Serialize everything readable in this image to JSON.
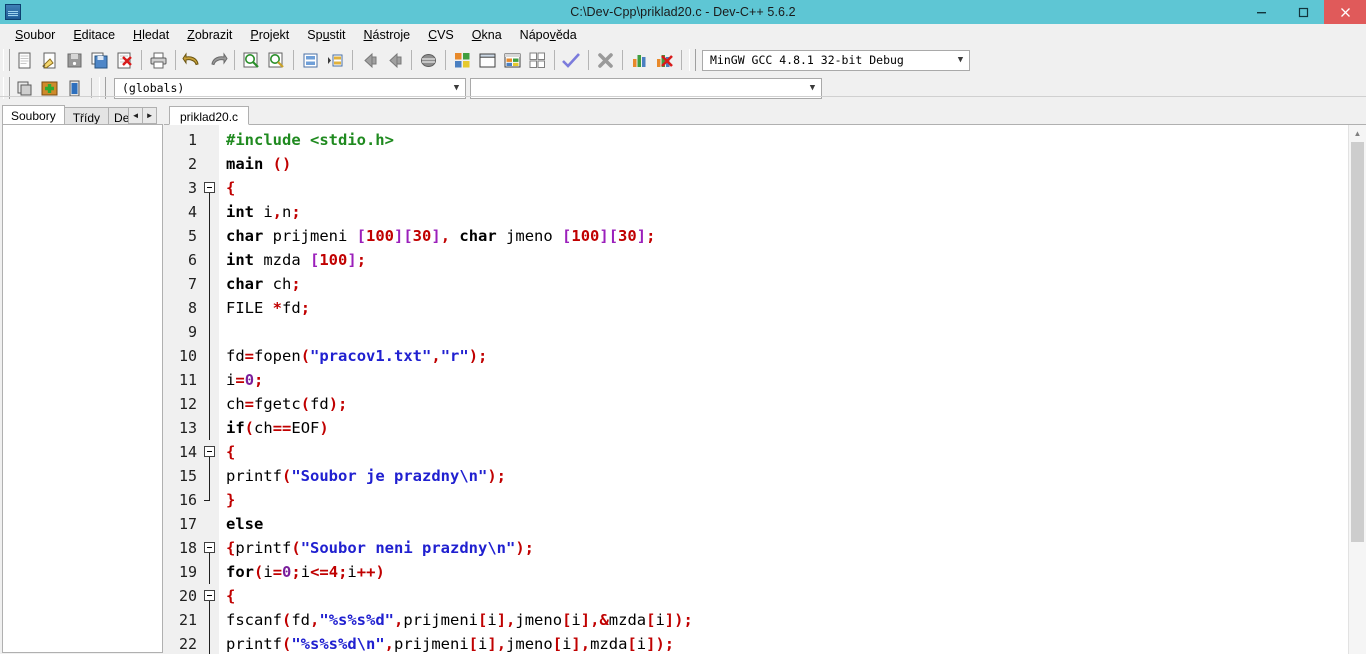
{
  "window": {
    "title": "C:\\Dev-Cpp\\priklad20.c - Dev-C++ 5.6.2",
    "app_icon": "devcpp-icon",
    "titlebar_color": "#5ec6d4",
    "close_color": "#e05a5a",
    "minimize_label": "–",
    "maximize_label": "❐",
    "close_label": "✕"
  },
  "menubar": {
    "items": [
      {
        "label": "Soubor",
        "accel": "S"
      },
      {
        "label": "Editace",
        "accel": "E"
      },
      {
        "label": "Hledat",
        "accel": "H"
      },
      {
        "label": "Zobrazit",
        "accel": "Z"
      },
      {
        "label": "Projekt",
        "accel": "P"
      },
      {
        "label": "Spustit",
        "accel": "u"
      },
      {
        "label": "Nástroje",
        "accel": "N"
      },
      {
        "label": "CVS",
        "accel": "C"
      },
      {
        "label": "Okna",
        "accel": "O"
      },
      {
        "label": "Nápověda",
        "accel": "v"
      }
    ]
  },
  "toolbar1": {
    "buttons": [
      {
        "name": "new-file-icon",
        "tooltip": "Nový zdrojový soubor"
      },
      {
        "name": "open-file-icon",
        "tooltip": "Otevřít"
      },
      {
        "name": "save-file-icon",
        "tooltip": "Uložit"
      },
      {
        "name": "save-all-icon",
        "tooltip": "Uložit vše"
      },
      {
        "name": "close-file-icon",
        "tooltip": "Zavřít"
      },
      {
        "name": "print-icon",
        "tooltip": "Tisk"
      },
      {
        "name": "undo-icon",
        "tooltip": "Zpět"
      },
      {
        "name": "redo-icon",
        "tooltip": "Znovu"
      },
      {
        "name": "find-icon",
        "tooltip": "Hledat"
      },
      {
        "name": "replace-icon",
        "tooltip": "Nahradit"
      },
      {
        "name": "goto-line-icon",
        "tooltip": "Jít na řádek"
      },
      {
        "name": "indent-icon",
        "tooltip": "Odsadit"
      },
      {
        "name": "back-icon",
        "tooltip": "Zpět"
      },
      {
        "name": "forward-icon",
        "tooltip": "Vpřed"
      },
      {
        "name": "toggle-bookmark-icon",
        "tooltip": "Záložka"
      },
      {
        "name": "compile-icon",
        "tooltip": "Přeložit"
      },
      {
        "name": "run-icon",
        "tooltip": "Spustit"
      },
      {
        "name": "compile-run-icon",
        "tooltip": "Přeložit a spustit"
      },
      {
        "name": "rebuild-all-icon",
        "tooltip": "Přeložit vše"
      },
      {
        "name": "syntax-check-icon",
        "tooltip": "Kontrola syntaxe"
      },
      {
        "name": "stop-execution-icon",
        "tooltip": "Zastavit"
      },
      {
        "name": "profile-icon",
        "tooltip": "Profilování"
      },
      {
        "name": "delete-profile-icon",
        "tooltip": "Smazat profil"
      }
    ],
    "compiler_combo": {
      "value": "MinGW GCC 4.8.1 32-bit Debug",
      "arrow": "▼"
    }
  },
  "toolbar2": {
    "buttons": [
      {
        "name": "new-project-icon",
        "tooltip": "Nový projekt"
      },
      {
        "name": "add-to-project-icon",
        "tooltip": "Přidat do projektu"
      },
      {
        "name": "remove-from-project-icon",
        "tooltip": "Odebrat z projektu"
      }
    ],
    "class_combo": {
      "value": "(globals)",
      "arrow": "▼"
    },
    "member_combo": {
      "value": "",
      "arrow": "▼"
    }
  },
  "left_panel": {
    "tabs": [
      {
        "label": "Soubory",
        "active": true
      },
      {
        "label": "Třídy",
        "active": false
      },
      {
        "label": "De",
        "active": false,
        "clipped": true
      }
    ],
    "scroll_left": "◄",
    "scroll_right": "►"
  },
  "editor": {
    "tabs": [
      {
        "label": "priklad20.c",
        "active": true
      }
    ],
    "scrollbar": {
      "up_arrow": "▲",
      "down_arrow": "▼"
    },
    "lines": [
      {
        "n": "1",
        "fold": "none",
        "tokens": [
          {
            "t": "#include <stdio.h>",
            "c": "t-pre"
          }
        ]
      },
      {
        "n": "2",
        "fold": "none",
        "tokens": [
          {
            "t": "main ",
            "c": "t-kw"
          },
          {
            "t": "()",
            "c": "t-sym"
          }
        ]
      },
      {
        "n": "3",
        "fold": "open",
        "tokens": [
          {
            "t": "{",
            "c": "t-brace"
          }
        ]
      },
      {
        "n": "4",
        "fold": "body",
        "tokens": [
          {
            "t": "int",
            "c": "t-kw"
          },
          {
            "t": " i",
            "c": "t-id"
          },
          {
            "t": ",",
            "c": "t-sym"
          },
          {
            "t": "n",
            "c": "t-id"
          },
          {
            "t": ";",
            "c": "t-sym"
          }
        ]
      },
      {
        "n": "5",
        "fold": "body",
        "tokens": [
          {
            "t": "char",
            "c": "t-kw"
          },
          {
            "t": " prijmeni ",
            "c": "t-id"
          },
          {
            "t": "[",
            "c": "t-brk"
          },
          {
            "t": "100",
            "c": "t-num"
          },
          {
            "t": "][",
            "c": "t-brk"
          },
          {
            "t": "30",
            "c": "t-num"
          },
          {
            "t": "]",
            "c": "t-brk"
          },
          {
            "t": ",",
            "c": "t-sym"
          },
          {
            "t": " ",
            "c": "t-id"
          },
          {
            "t": "char",
            "c": "t-kw"
          },
          {
            "t": " jmeno ",
            "c": "t-id"
          },
          {
            "t": "[",
            "c": "t-brk"
          },
          {
            "t": "100",
            "c": "t-num"
          },
          {
            "t": "][",
            "c": "t-brk"
          },
          {
            "t": "30",
            "c": "t-num"
          },
          {
            "t": "]",
            "c": "t-brk"
          },
          {
            "t": ";",
            "c": "t-sym"
          }
        ]
      },
      {
        "n": "6",
        "fold": "body",
        "tokens": [
          {
            "t": "int",
            "c": "t-kw"
          },
          {
            "t": " mzda ",
            "c": "t-id"
          },
          {
            "t": "[",
            "c": "t-brk"
          },
          {
            "t": "100",
            "c": "t-num"
          },
          {
            "t": "]",
            "c": "t-brk"
          },
          {
            "t": ";",
            "c": "t-sym"
          }
        ]
      },
      {
        "n": "7",
        "fold": "body",
        "tokens": [
          {
            "t": "char",
            "c": "t-kw"
          },
          {
            "t": " ch",
            "c": "t-id"
          },
          {
            "t": ";",
            "c": "t-sym"
          }
        ]
      },
      {
        "n": "8",
        "fold": "body",
        "tokens": [
          {
            "t": "FILE ",
            "c": "t-id"
          },
          {
            "t": "*",
            "c": "t-sym"
          },
          {
            "t": "fd",
            "c": "t-id"
          },
          {
            "t": ";",
            "c": "t-sym"
          }
        ]
      },
      {
        "n": "9",
        "fold": "body",
        "tokens": []
      },
      {
        "n": "10",
        "fold": "body",
        "tokens": [
          {
            "t": "fd",
            "c": "t-id"
          },
          {
            "t": "=",
            "c": "t-sym"
          },
          {
            "t": "fopen",
            "c": "t-id"
          },
          {
            "t": "(",
            "c": "t-sym"
          },
          {
            "t": "\"pracov1.txt\"",
            "c": "t-str"
          },
          {
            "t": ",",
            "c": "t-sym"
          },
          {
            "t": "\"r\"",
            "c": "t-str"
          },
          {
            "t": ")",
            "c": "t-sym"
          },
          {
            "t": ";",
            "c": "t-sym"
          }
        ]
      },
      {
        "n": "11",
        "fold": "body",
        "tokens": [
          {
            "t": "i",
            "c": "t-id"
          },
          {
            "t": "=",
            "c": "t-sym"
          },
          {
            "t": "0",
            "c": "t-num2"
          },
          {
            "t": ";",
            "c": "t-sym"
          }
        ]
      },
      {
        "n": "12",
        "fold": "body",
        "tokens": [
          {
            "t": "ch",
            "c": "t-id"
          },
          {
            "t": "=",
            "c": "t-sym"
          },
          {
            "t": "fgetc",
            "c": "t-id"
          },
          {
            "t": "(",
            "c": "t-sym"
          },
          {
            "t": "fd",
            "c": "t-id"
          },
          {
            "t": ")",
            "c": "t-sym"
          },
          {
            "t": ";",
            "c": "t-sym"
          }
        ]
      },
      {
        "n": "13",
        "fold": "body",
        "tokens": [
          {
            "t": "if",
            "c": "t-kw"
          },
          {
            "t": "(",
            "c": "t-sym"
          },
          {
            "t": "ch",
            "c": "t-id"
          },
          {
            "t": "==",
            "c": "t-sym"
          },
          {
            "t": "EOF",
            "c": "t-id"
          },
          {
            "t": ")",
            "c": "t-sym"
          }
        ]
      },
      {
        "n": "14",
        "fold": "open",
        "tokens": [
          {
            "t": "{",
            "c": "t-brace"
          }
        ]
      },
      {
        "n": "15",
        "fold": "body",
        "tokens": [
          {
            "t": "printf",
            "c": "t-id"
          },
          {
            "t": "(",
            "c": "t-sym"
          },
          {
            "t": "\"Soubor je prazdny\\n\"",
            "c": "t-str"
          },
          {
            "t": ")",
            "c": "t-sym"
          },
          {
            "t": ";",
            "c": "t-sym"
          }
        ]
      },
      {
        "n": "16",
        "fold": "close",
        "tokens": [
          {
            "t": "}",
            "c": "t-brace"
          }
        ]
      },
      {
        "n": "17",
        "fold": "none",
        "tokens": [
          {
            "t": "else",
            "c": "t-kw"
          }
        ]
      },
      {
        "n": "18",
        "fold": "open",
        "tokens": [
          {
            "t": "{",
            "c": "t-brace"
          },
          {
            "t": "printf",
            "c": "t-id"
          },
          {
            "t": "(",
            "c": "t-sym"
          },
          {
            "t": "\"Soubor neni prazdny\\n\"",
            "c": "t-str"
          },
          {
            "t": ")",
            "c": "t-sym"
          },
          {
            "t": ";",
            "c": "t-sym"
          }
        ]
      },
      {
        "n": "19",
        "fold": "body",
        "tokens": [
          {
            "t": "for",
            "c": "t-kw"
          },
          {
            "t": "(",
            "c": "t-sym"
          },
          {
            "t": "i",
            "c": "t-id"
          },
          {
            "t": "=",
            "c": "t-sym"
          },
          {
            "t": "0",
            "c": "t-num2"
          },
          {
            "t": ";",
            "c": "t-sym"
          },
          {
            "t": "i",
            "c": "t-id"
          },
          {
            "t": "<=",
            "c": "t-sym"
          },
          {
            "t": "4",
            "c": "t-num"
          },
          {
            "t": ";",
            "c": "t-sym"
          },
          {
            "t": "i",
            "c": "t-id"
          },
          {
            "t": "++",
            "c": "t-sym"
          },
          {
            "t": ")",
            "c": "t-sym"
          }
        ]
      },
      {
        "n": "20",
        "fold": "open",
        "tokens": [
          {
            "t": "{",
            "c": "t-brace"
          }
        ]
      },
      {
        "n": "21",
        "fold": "body",
        "tokens": [
          {
            "t": "fscanf",
            "c": "t-id"
          },
          {
            "t": "(",
            "c": "t-sym"
          },
          {
            "t": "fd",
            "c": "t-id"
          },
          {
            "t": ",",
            "c": "t-sym"
          },
          {
            "t": "\"%s%s%d\"",
            "c": "t-str"
          },
          {
            "t": ",",
            "c": "t-sym"
          },
          {
            "t": "prijmeni",
            "c": "t-id"
          },
          {
            "t": "[",
            "c": "t-sym"
          },
          {
            "t": "i",
            "c": "t-id"
          },
          {
            "t": "]",
            "c": "t-sym"
          },
          {
            "t": ",",
            "c": "t-sym"
          },
          {
            "t": "jmeno",
            "c": "t-id"
          },
          {
            "t": "[",
            "c": "t-sym"
          },
          {
            "t": "i",
            "c": "t-id"
          },
          {
            "t": "]",
            "c": "t-sym"
          },
          {
            "t": ",",
            "c": "t-sym"
          },
          {
            "t": "&",
            "c": "t-sym"
          },
          {
            "t": "mzda",
            "c": "t-id"
          },
          {
            "t": "[",
            "c": "t-sym"
          },
          {
            "t": "i",
            "c": "t-id"
          },
          {
            "t": "]",
            "c": "t-sym"
          },
          {
            "t": ")",
            "c": "t-sym"
          },
          {
            "t": ";",
            "c": "t-sym"
          }
        ]
      },
      {
        "n": "22",
        "fold": "body",
        "tokens": [
          {
            "t": "printf",
            "c": "t-id"
          },
          {
            "t": "(",
            "c": "t-sym"
          },
          {
            "t": "\"%s%s%d\\n\"",
            "c": "t-str"
          },
          {
            "t": ",",
            "c": "t-sym"
          },
          {
            "t": "prijmeni",
            "c": "t-id"
          },
          {
            "t": "[",
            "c": "t-sym"
          },
          {
            "t": "i",
            "c": "t-id"
          },
          {
            "t": "]",
            "c": "t-sym"
          },
          {
            "t": ",",
            "c": "t-sym"
          },
          {
            "t": "jmeno",
            "c": "t-id"
          },
          {
            "t": "[",
            "c": "t-sym"
          },
          {
            "t": "i",
            "c": "t-id"
          },
          {
            "t": "]",
            "c": "t-sym"
          },
          {
            "t": ",",
            "c": "t-sym"
          },
          {
            "t": "mzda",
            "c": "t-id"
          },
          {
            "t": "[",
            "c": "t-sym"
          },
          {
            "t": "i",
            "c": "t-id"
          },
          {
            "t": "]",
            "c": "t-sym"
          },
          {
            "t": ")",
            "c": "t-sym"
          },
          {
            "t": ";",
            "c": "t-sym"
          }
        ]
      }
    ]
  }
}
